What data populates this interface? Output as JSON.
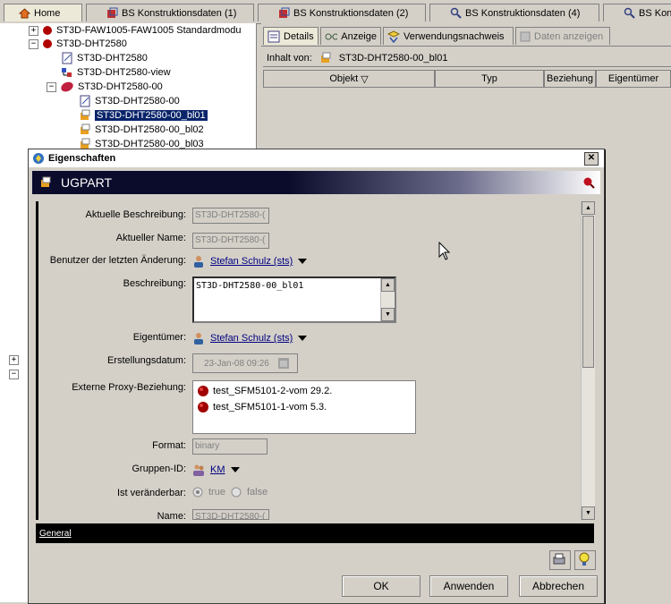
{
  "top_tabs": [
    {
      "label": "Home",
      "icon": "home-icon"
    },
    {
      "label": "BS Konstruktionsdaten (1)",
      "icon": "part-icon"
    },
    {
      "label": "BS Konstruktionsdaten (2)",
      "icon": "part-icon"
    },
    {
      "label": "BS Konstruktionsdaten (4)",
      "icon": "search-icon"
    },
    {
      "label": "BS Kon",
      "icon": "search-icon"
    }
  ],
  "tree": {
    "items": [
      {
        "label": "ST3D-FAW1005-FAW1005 Standardmodu"
      },
      {
        "label": "ST3D-DHT2580"
      },
      {
        "label": "ST3D-DHT2580"
      },
      {
        "label": "ST3D-DHT2580-view"
      },
      {
        "label": "ST3D-DHT2580-00"
      },
      {
        "label": "ST3D-DHT2580-00"
      },
      {
        "label": "ST3D-DHT2580-00_bl01"
      },
      {
        "label": "ST3D-DHT2580-00_bl02"
      },
      {
        "label": "ST3D-DHT2580-00_bl03"
      }
    ]
  },
  "right_panel": {
    "tabs": [
      {
        "label": "Details"
      },
      {
        "label": "Anzeige"
      },
      {
        "label": "Verwendungsnachweis"
      },
      {
        "label": "Daten anzeigen"
      }
    ],
    "inhalt_label": "Inhalt von:",
    "inhalt_value": "ST3D-DHT2580-00_bl01",
    "columns": [
      "Objekt",
      "Typ",
      "Beziehung",
      "Eigentümer"
    ]
  },
  "dialog": {
    "title": "Eigenschaften",
    "header": "UGPART",
    "fields": {
      "aktuelle_beschreibung": {
        "label": "Aktuelle Beschreibung:",
        "value": "ST3D-DHT2580-("
      },
      "aktueller_name": {
        "label": "Aktueller Name:",
        "value": "ST3D-DHT2580-("
      },
      "benutzer": {
        "label": "Benutzer der letzten Änderung:",
        "value": "Stefan Schulz (sts)"
      },
      "beschreibung": {
        "label": "Beschreibung:",
        "value": "ST3D-DHT2580-00_bl01"
      },
      "eigentuemer": {
        "label": "Eigentümer:",
        "value": "Stefan Schulz (sts)"
      },
      "erstellungsdatum": {
        "label": "Erstellungsdatum:",
        "value": "23-Jan-08 09:26"
      },
      "proxy": {
        "label": "Externe Proxy-Beziehung:",
        "items": [
          "test_SFM5101-2-vom 29.2.",
          "test_SFM5101-1-vom 5.3."
        ]
      },
      "format": {
        "label": "Format:",
        "value": "binary"
      },
      "gruppen_id": {
        "label": "Gruppen-ID:",
        "value": "KM"
      },
      "veraenderbar": {
        "label": "Ist veränderbar:",
        "opt_true": "true",
        "opt_false": "false",
        "selected": "true"
      },
      "name": {
        "label": "Name:",
        "value": "ST3D-DHT2580-("
      }
    },
    "section_tab": "General",
    "buttons": {
      "ok": "OK",
      "apply": "Anwenden",
      "cancel": "Abbrechen"
    }
  },
  "colors": {
    "selection": "#0a246a",
    "link": "#000080",
    "banner_dark": "#0b0b2c"
  }
}
